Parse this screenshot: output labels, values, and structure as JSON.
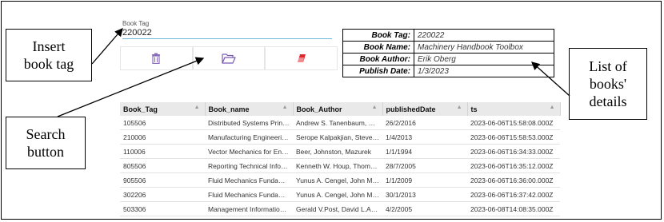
{
  "form": {
    "tag_label": "Book Tag",
    "tag_value": "220022"
  },
  "buttons": [
    {
      "icon": "trash-icon",
      "color": "#8a6bbf"
    },
    {
      "icon": "folder-open-icon",
      "color": "#7a5ab5"
    },
    {
      "icon": "eraser-icon",
      "color": "#e0262d"
    }
  ],
  "details": {
    "rows": [
      {
        "label": "Book Tag:",
        "value": "220022"
      },
      {
        "label": "Book Name:",
        "value": "Machinery Handbook Toolbox"
      },
      {
        "label": "Book Author:",
        "value": "Erik Oberg"
      },
      {
        "label": "Publish Date:",
        "value": "1/3/2023"
      }
    ]
  },
  "grid": {
    "columns": [
      "Book_Tag",
      "Book_name",
      "Book_Author",
      "publishedDate",
      "ts"
    ],
    "rows": [
      [
        "105506",
        "Distributed Systems Principles ...",
        "Andrew S. Tanenbaum, Maarte...",
        "26/2/2016",
        "2023-06-06T15:58:08.000Z"
      ],
      [
        "210006",
        "Manufacturing Engineering an...",
        "Serope Kalpakjian, Steven R.Sc...",
        "1/4/2013",
        "2023-06-06T15:58:53.000Z"
      ],
      [
        "110006",
        "Vector Mechanics for Engineers",
        "Beer, Johnston, Mazurek",
        "1/1/1994",
        "2023-06-06T16:34:33.000Z"
      ],
      [
        "805506",
        "Reporting Technical Information",
        "Kenneth W. Houp, Thomas E. P...",
        "28/7/2005",
        "2023-06-06T16:35:12.000Z"
      ],
      [
        "905506",
        "Fluid Mechanics Fundamentals ...",
        "Yunus A. Cengel, John M. Cimb...",
        "1/1/2009",
        "2023-06-06T16:36:00.000Z"
      ],
      [
        "302206",
        "Fluid Mechanics Fundamentals ...",
        "Yunus A. Cengel, John M.Cimb...",
        "30/1/2013",
        "2023-06-06T16:37:42.000Z"
      ],
      [
        "503306",
        "Management Information Syste...",
        "Gerald V.Post, David L.Anderson",
        "4/2/2005",
        "2023-06-08T14:08:35.000Z"
      ]
    ]
  },
  "callouts": {
    "insert": [
      "Insert",
      "book tag"
    ],
    "search": [
      "Search",
      "button"
    ],
    "list": [
      "List of",
      "books'",
      "details"
    ]
  }
}
